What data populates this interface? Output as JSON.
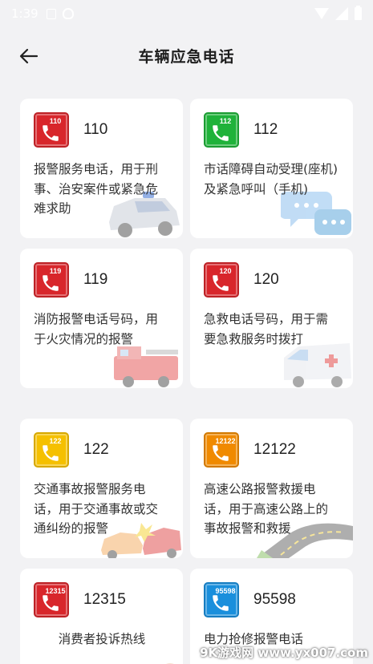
{
  "status_bar": {
    "time": "1:39"
  },
  "header": {
    "title": "车辆应急电话"
  },
  "cards": [
    {
      "number": "110",
      "badge": "110",
      "color": "#d8262b",
      "desc": "报警服务电话，用于刑事、治安案件或紧急危难求助",
      "illustration": "police-car"
    },
    {
      "number": "112",
      "badge": "112",
      "color": "#1fb23a",
      "desc": "市话障碍自动受理(座机)及紧急呼叫（手机)",
      "illustration": "chat-bubbles"
    },
    {
      "number": "119",
      "badge": "119",
      "color": "#d8262b",
      "desc": "消防报警电话号码，用于火灾情况的报警",
      "illustration": "fire-truck"
    },
    {
      "number": "120",
      "badge": "120",
      "color": "#d8262b",
      "desc": "急救电话号码，用于需要急救服务时拨打",
      "illustration": "ambulance"
    },
    {
      "number": "122",
      "badge": "122",
      "color": "#f5c000",
      "desc": "交通事故报警服务电话，用于交通事故或交通纠纷的报警",
      "illustration": "car-crash"
    },
    {
      "number": "12122",
      "badge": "12122",
      "color": "#f08a00",
      "desc": "高速公路报警救援电话，用于高速公路上的事故报警和救援",
      "illustration": "highway"
    },
    {
      "number": "12315",
      "badge": "12315",
      "color": "#d8262b",
      "desc": "消费者投诉热线",
      "illustration": "person"
    },
    {
      "number": "95598",
      "badge": "95598",
      "color": "#1a8fdc",
      "desc": "电力抢修报警电话",
      "illustration": "power"
    }
  ],
  "watermark": "9K游戏网 www.yx007.com"
}
